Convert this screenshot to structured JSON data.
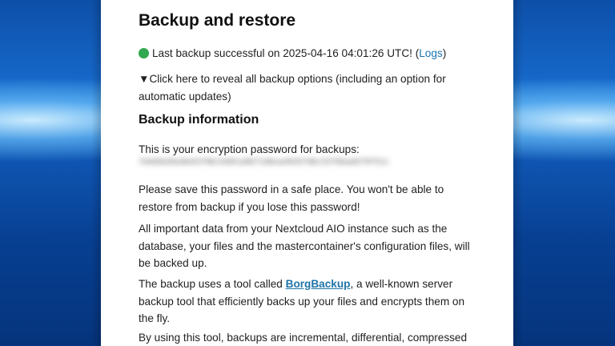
{
  "page": {
    "title": "Backup and restore",
    "status": {
      "text": "Last backup successful on 2025-04-16 04:01:26 UTC! (",
      "logs_link": "Logs",
      "close": ")",
      "color": "#2fa84f"
    },
    "toggle_text": "▼Click here to reveal all backup options (including an option for automatic updates)",
    "backup_info": {
      "heading": "Backup information",
      "password_label": "This is your encryption password for backups:",
      "password_value": "7d4d9a5be8e63f0b14d91a9bf1d6ea4935fdbc5376bad5f9f51c",
      "save_note": "Please save this password in a safe place. You won't be able to restore from backup if you lose this password!",
      "data_note": "All important data from your Nextcloud AIO instance such as the database, your files and the mastercontainer's configuration files, will be backed up.",
      "tool_pre": "The backup uses a tool called ",
      "tool_link": "BorgBackup",
      "tool_post": ", a well-known server backup tool that efficiently backs up your files and encrypts them on the fly.",
      "using_note": "By using this tool, backups are incremental, differential, compressed"
    }
  }
}
